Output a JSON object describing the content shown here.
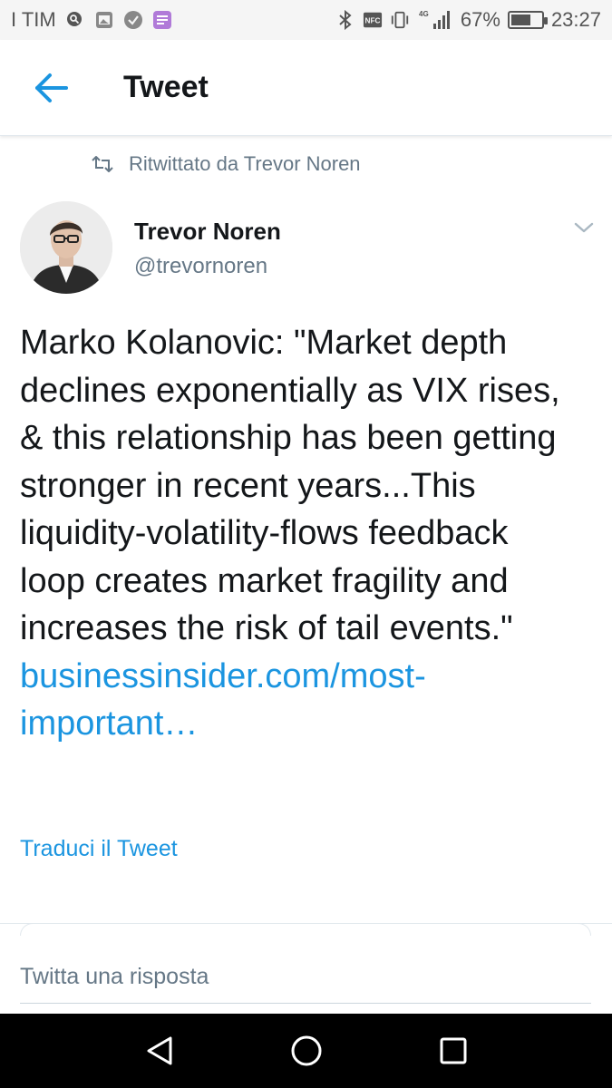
{
  "status_bar": {
    "carrier": "I TIM",
    "network": "4G",
    "battery_level": 0.67,
    "battery_text": "67%",
    "time": "23:27",
    "icons": [
      "search-notification-icon",
      "gallery-notification-icon",
      "check-notification-icon",
      "message-notification-icon",
      "bluetooth-icon",
      "nfc-icon",
      "vibrate-icon",
      "signal-icon",
      "battery-icon"
    ]
  },
  "header": {
    "title": "Tweet",
    "back_icon": "back-arrow-icon"
  },
  "retweet": {
    "icon": "retweet-icon",
    "label": "Ritwittato da Trevor Noren"
  },
  "author": {
    "name": "Trevor Noren",
    "handle": "@trevornoren"
  },
  "tweet": {
    "text": "Marko Kolanovic: \"Market depth declines exponentially as VIX rises, & this relationship has been getting stronger in recent years...This liquidity-volatility-flows feedback loop creates market fragility and increases the risk of tail events.\"",
    "link": "businessinsider.com/most-important…",
    "translate_label": "Traduci il Tweet"
  },
  "reply": {
    "placeholder": "Twitta una risposta"
  },
  "colors": {
    "accent": "#1b95e0",
    "secondary_text": "#657786",
    "primary_text": "#14171a"
  }
}
